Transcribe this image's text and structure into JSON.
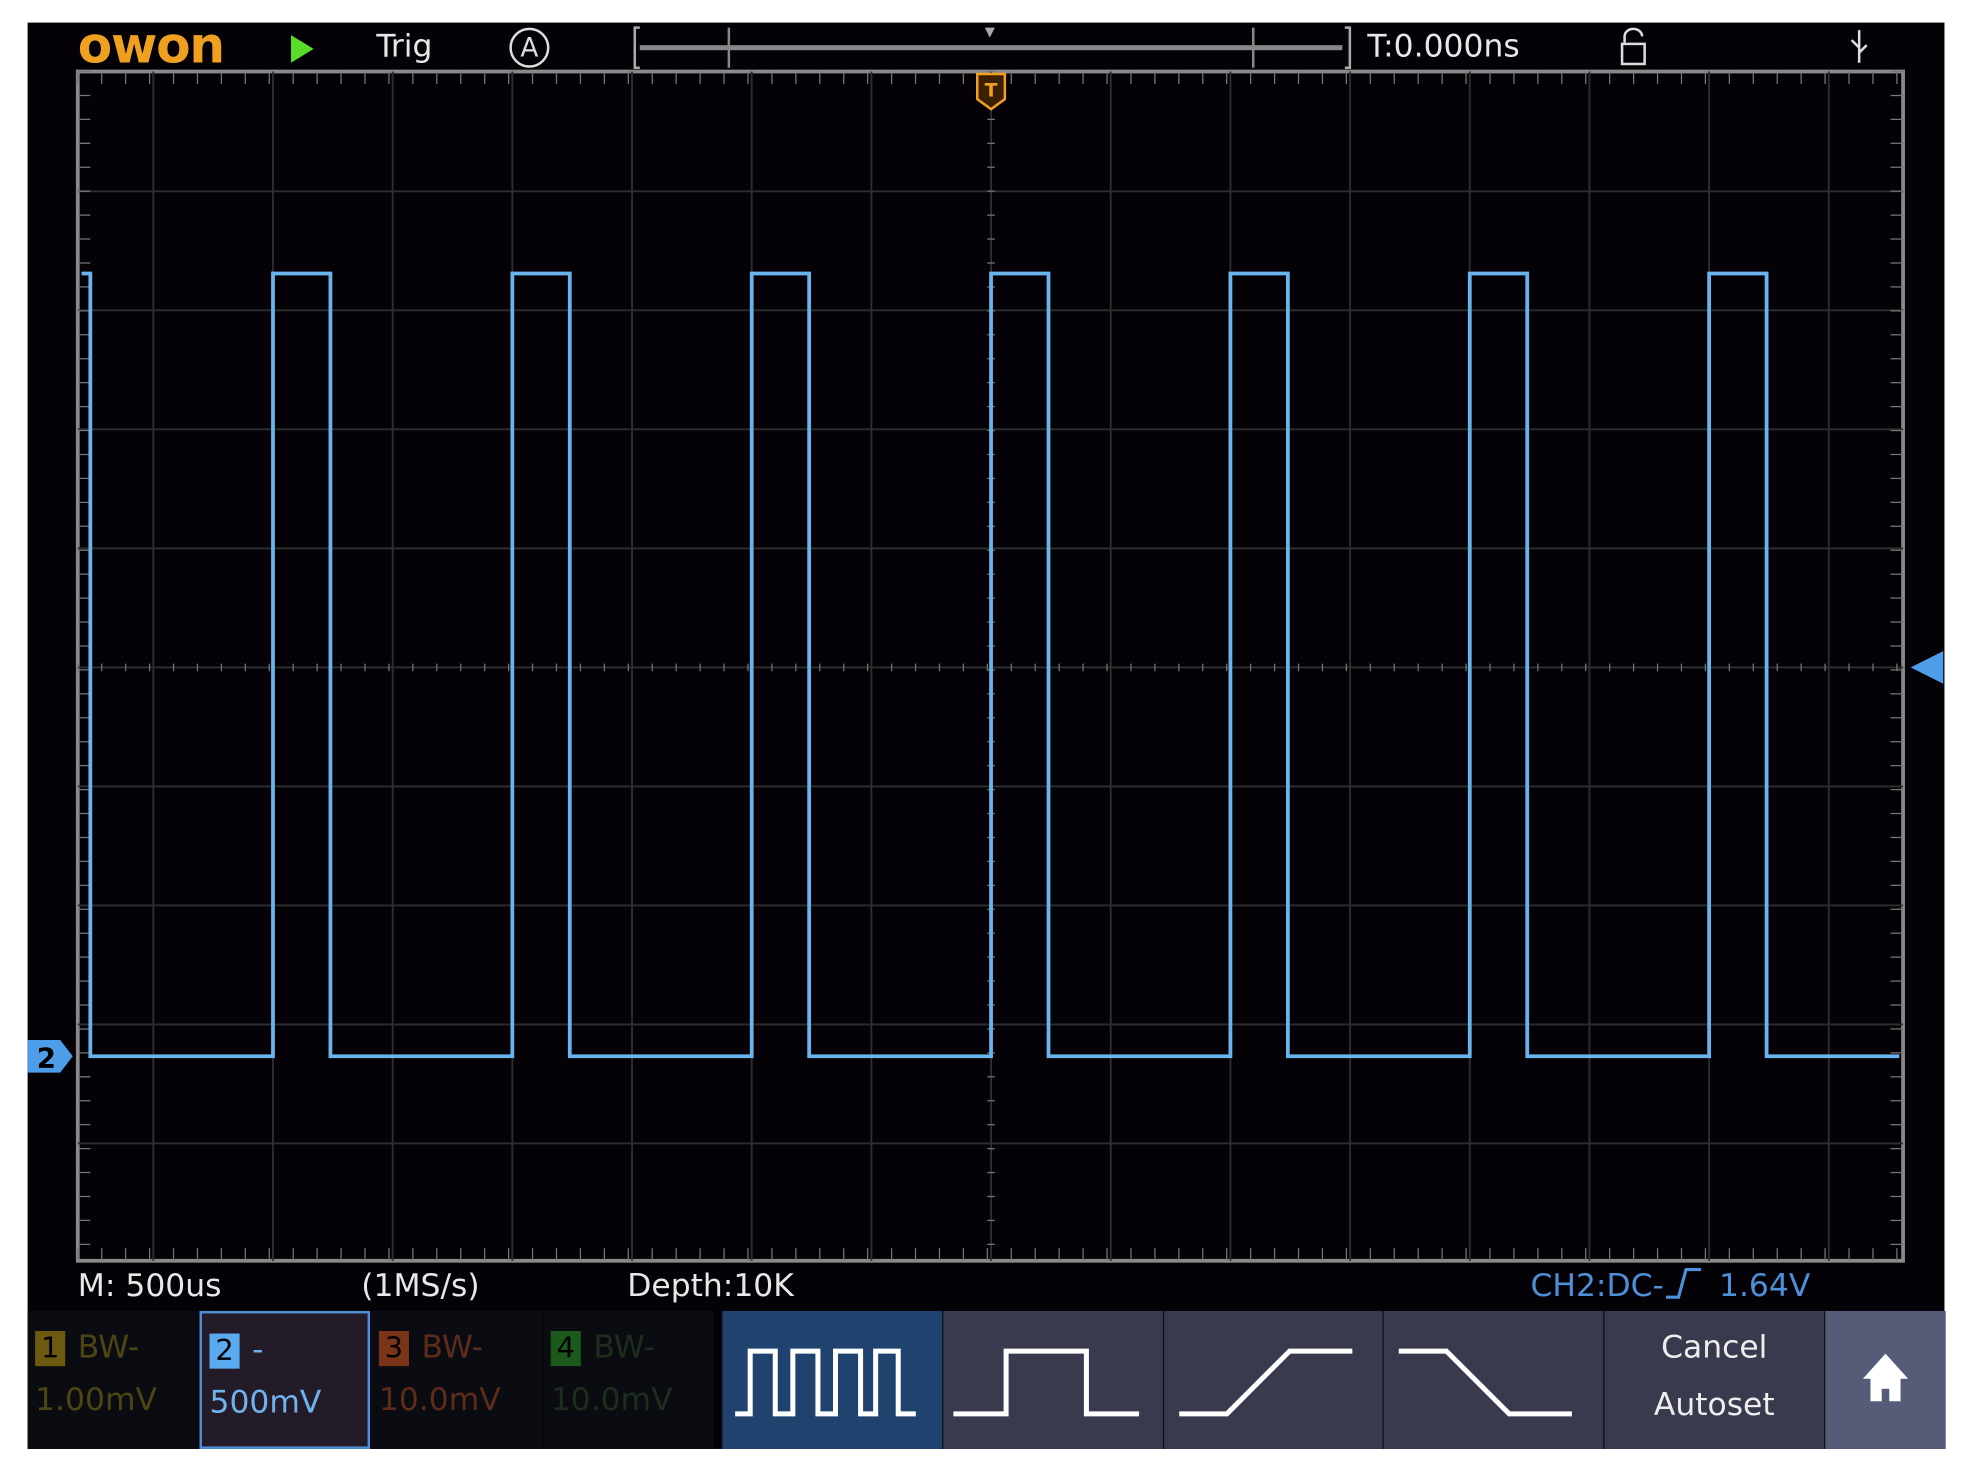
{
  "brand": "owon",
  "status": {
    "run_state": "play-icon",
    "trigger_status": "Trig",
    "trigger_mode": "A",
    "trigger_time": "T:0.000ns",
    "lock": "lock-icon",
    "usb": "usb-icon"
  },
  "footer": {
    "timebase": "M: 500us",
    "sample_rate": "(1MS/s)",
    "depth": "Depth:10K",
    "trigger_info": "CH2:DC-",
    "trigger_level": "1.64V"
  },
  "channels": [
    {
      "num": "1",
      "bw": "BW-",
      "scale": "1.00mV",
      "color": "#6b5a10",
      "text_color": "#4d4512",
      "selected": false
    },
    {
      "num": "2",
      "bw": "-",
      "scale": "500mV",
      "color": "#5aaaf0",
      "text_color": "#6fb2ee",
      "selected": true
    },
    {
      "num": "3",
      "bw": "BW-",
      "scale": "10.0mV",
      "color": "#7a3518",
      "text_color": "#5d2c1a",
      "selected": false
    },
    {
      "num": "4",
      "bw": "BW-",
      "scale": "10.0mV",
      "color": "#1c5a1c",
      "text_color": "#1c2e1c",
      "selected": false
    }
  ],
  "autoset_menu": {
    "options": [
      "multi-period-icon",
      "single-period-icon",
      "rising-edge-icon",
      "falling-edge-icon"
    ],
    "selected": 0,
    "cancel": "Cancel",
    "autoset": "Autoset",
    "home": "home-icon"
  },
  "waveform": {
    "channel": "2",
    "color": "#6ab4ee",
    "timebase_us_per_div": 500,
    "period_us": 1000,
    "high_time_us": 240,
    "first_rising_us_from_trigger": -3000,
    "high_level_div": 6.55,
    "low_level_div": -0.0,
    "channel_offset_div": -3.3
  }
}
